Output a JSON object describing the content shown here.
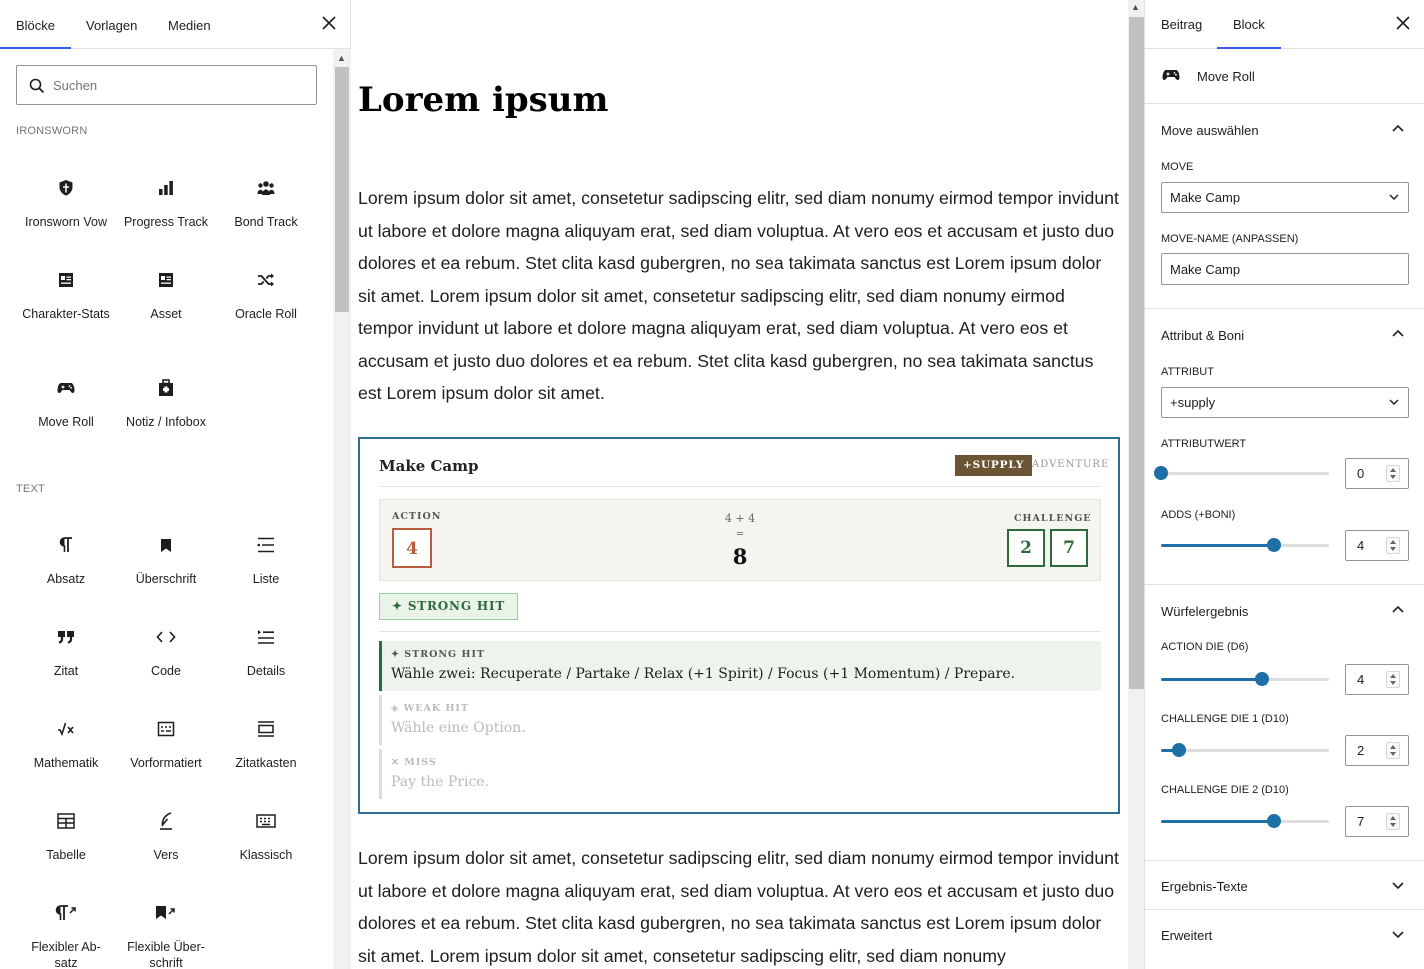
{
  "inserter": {
    "tabs": [
      "Blöcke",
      "Vorlagen",
      "Medien"
    ],
    "active_tab": "Blöcke",
    "search_placeholder": "Suchen",
    "categories": [
      {
        "name": "IRONSWORN",
        "blocks": [
          {
            "label": "Ironsworn Vow",
            "icon": "shield-icon"
          },
          {
            "label": "Progress Track",
            "icon": "bar-chart-icon"
          },
          {
            "label": "Bond Track",
            "icon": "users-icon"
          },
          {
            "label": "Charakter-Stats",
            "icon": "id-card-icon"
          },
          {
            "label": "Asset",
            "icon": "id-card-icon"
          },
          {
            "label": "Oracle Roll",
            "icon": "shuffle-icon"
          },
          {
            "label": "Move Roll",
            "icon": "gamepad-icon"
          },
          {
            "label": "Notiz / Infobox",
            "icon": "briefcase-icon"
          }
        ]
      },
      {
        "name": "TEXT",
        "blocks": [
          {
            "label": "Absatz",
            "icon": "paragraph-icon"
          },
          {
            "label": "Überschrift",
            "icon": "bookmark-icon"
          },
          {
            "label": "Liste",
            "icon": "list-icon"
          },
          {
            "label": "Zitat",
            "icon": "quote-icon"
          },
          {
            "label": "Code",
            "icon": "code-icon"
          },
          {
            "label": "Details",
            "icon": "details-icon"
          },
          {
            "label": "Mathematik",
            "icon": "math-icon"
          },
          {
            "label": "Vorformatiert",
            "icon": "preformatted-icon"
          },
          {
            "label": "Zitatkasten",
            "icon": "pullquote-icon"
          },
          {
            "label": "Tabelle",
            "icon": "table-icon"
          },
          {
            "label": "Vers",
            "icon": "verse-icon"
          },
          {
            "label": "Klassisch",
            "icon": "keyboard-icon"
          },
          {
            "label": "Flexibler Ab-satz",
            "icon": "paragraph-arrow-icon"
          },
          {
            "label": "Flexible Über-schrift",
            "icon": "bookmark-arrow-icon"
          }
        ]
      }
    ]
  },
  "editor": {
    "title": "Lorem ipsum",
    "paragraph1": "Lorem ipsum dolor sit amet, consetetur sadipscing elitr, sed diam nonumy eirmod tempor invidunt ut labore et dolore magna aliquyam erat, sed diam voluptua. At vero eos et accusam et justo duo dolores et ea rebum. Stet clita kasd gubergren, no sea takimata sanctus est Lorem ipsum dolor sit amet. Lorem ipsum dolor sit amet, consetetur sadipscing elitr, sed diam nonumy eirmod tempor invidunt ut labore et dolore magna aliquyam erat, sed diam voluptua. At vero eos et accusam et justo duo dolores et ea rebum. Stet clita kasd gubergren, no sea takimata sanctus est Lorem ipsum dolor sit amet.",
    "paragraph2": "Lorem ipsum dolor sit amet, consetetur sadipscing elitr, sed diam nonumy eirmod tempor invidunt ut labore et dolore magna aliquyam erat, sed diam voluptua. At vero eos et accusam et justo duo dolores et ea rebum. Stet clita kasd gubergren, no sea takimata sanctus est Lorem ipsum dolor sit amet. Lorem ipsum dolor sit amet, consetetur sadipscing elitr, sed diam nonumy",
    "move_block": {
      "title": "Make Camp",
      "badge": "+SUPPLY",
      "category": "ADVENTURE",
      "action_label": "ACTION",
      "action_die": "4",
      "sum_expression": "4 + 4",
      "equals": "=",
      "total": "8",
      "challenge_label": "CHALLENGE",
      "challenge_dice": [
        "2",
        "7"
      ],
      "result": "✦ STRONG HIT",
      "outcomes": [
        {
          "heading": "✦ STRONG HIT",
          "text": "Wähle zwei: Recuperate / Partake / Relax (+1 Spirit) / Focus (+1 Momentum) / Prepare."
        },
        {
          "heading": "◈ WEAK HIT",
          "text": "Wähle eine Option."
        },
        {
          "heading": "✕ MISS",
          "text": "Pay the Price."
        }
      ],
      "colors": {
        "border": "#2c6e96",
        "badge": "#6b5433",
        "action": "#b55d3f",
        "challenge": "#2e6b3c"
      }
    }
  },
  "sidebar": {
    "tabs": [
      "Beitrag",
      "Block"
    ],
    "active_tab": "Block",
    "block_name": "Move Roll",
    "panels": {
      "move": {
        "title": "Move auswählen",
        "move_label": "MOVE",
        "move_value": "Make Camp",
        "name_label": "MOVE-NAME (ANPASSEN)",
        "name_value": "Make Camp"
      },
      "attribute": {
        "title": "Attribut & Boni",
        "attr_label": "ATTRIBUT",
        "attr_value": "+supply",
        "attr_value_label": "ATTRIBUTWERT",
        "attr_value_num": "0",
        "attr_value_fraction": 0.0,
        "adds_label": "ADDS (+BONI)",
        "adds_num": "4",
        "adds_fraction": 0.67
      },
      "dice": {
        "title": "Würfelergebnis",
        "action_label": "ACTION DIE (D6)",
        "action_num": "4",
        "action_fraction": 0.6,
        "ch1_label": "CHALLENGE DIE 1 (D10)",
        "ch1_num": "2",
        "ch1_fraction": 0.11,
        "ch2_label": "CHALLENGE DIE 2 (D10)",
        "ch2_num": "7",
        "ch2_fraction": 0.67
      },
      "results_text": {
        "title": "Ergebnis-Texte"
      },
      "advanced": {
        "title": "Erweitert"
      }
    },
    "accent_color": "#1e6fa6"
  }
}
